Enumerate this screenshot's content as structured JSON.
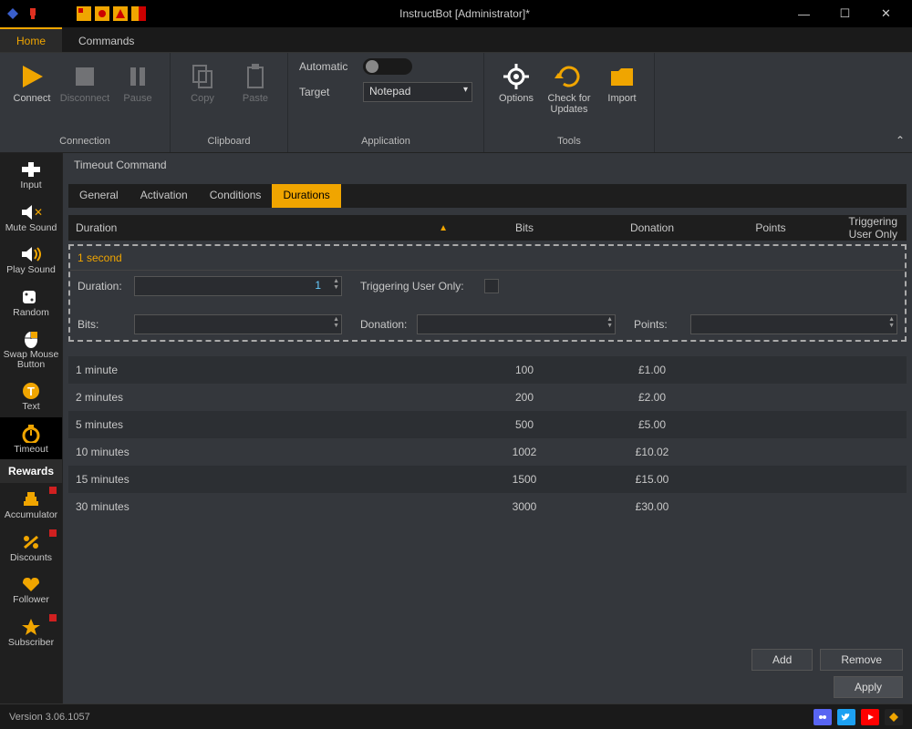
{
  "window": {
    "title": "InstructBot [Administrator]*"
  },
  "menubar": {
    "tabs": [
      "Home",
      "Commands"
    ],
    "active": 0
  },
  "ribbon": {
    "connection": {
      "label": "Connection",
      "connect": "Connect",
      "disconnect": "Disconnect",
      "pause": "Pause"
    },
    "clipboard": {
      "label": "Clipboard",
      "copy": "Copy",
      "paste": "Paste"
    },
    "application": {
      "label": "Application",
      "automatic": "Automatic",
      "target": "Target",
      "target_value": "Notepad"
    },
    "tools": {
      "label": "Tools",
      "options": "Options",
      "updates": "Check for\nUpdates",
      "import": "Import"
    }
  },
  "sidebar": {
    "items": [
      {
        "label": "Input",
        "icon": "dpad"
      },
      {
        "label": "Mute Sound",
        "icon": "speaker-mute"
      },
      {
        "label": "Play Sound",
        "icon": "speaker"
      },
      {
        "label": "Random",
        "icon": "dice"
      },
      {
        "label": "Swap Mouse Button",
        "icon": "mouse"
      },
      {
        "label": "Text",
        "icon": "text"
      },
      {
        "label": "Timeout",
        "icon": "stopwatch",
        "active": true
      },
      {
        "label": "Rewards",
        "icon": "",
        "header": true
      },
      {
        "label": "Accumulator",
        "icon": "stack",
        "badge": true
      },
      {
        "label": "Discounts",
        "icon": "percent",
        "badge": true
      },
      {
        "label": "Follower",
        "icon": "heart"
      },
      {
        "label": "Subscriber",
        "icon": "star",
        "badge": true
      }
    ]
  },
  "breadcrumb": "Timeout Command",
  "subtabs": {
    "items": [
      "General",
      "Activation",
      "Conditions",
      "Durations"
    ],
    "active": 3
  },
  "grid": {
    "headers": {
      "duration": "Duration",
      "bits": "Bits",
      "donation": "Donation",
      "points": "Points",
      "tuo": "Triggering User Only"
    },
    "edit": {
      "title": "1 second",
      "duration_label": "Duration:",
      "duration_value": "1",
      "tuo_label": "Triggering User Only:",
      "bits_label": "Bits:",
      "bits_value": "",
      "donation_label": "Donation:",
      "donation_value": "",
      "points_label": "Points:",
      "points_value": ""
    },
    "rows": [
      {
        "duration": "1 minute",
        "bits": "100",
        "donation": "£1.00"
      },
      {
        "duration": "2 minutes",
        "bits": "200",
        "donation": "£2.00"
      },
      {
        "duration": "5 minutes",
        "bits": "500",
        "donation": "£5.00"
      },
      {
        "duration": "10 minutes",
        "bits": "1002",
        "donation": "£10.02"
      },
      {
        "duration": "15 minutes",
        "bits": "1500",
        "donation": "£15.00"
      },
      {
        "duration": "30 minutes",
        "bits": "3000",
        "donation": "£30.00"
      }
    ]
  },
  "buttons": {
    "add": "Add",
    "remove": "Remove",
    "apply": "Apply"
  },
  "status": {
    "version": "Version 3.06.1057"
  }
}
